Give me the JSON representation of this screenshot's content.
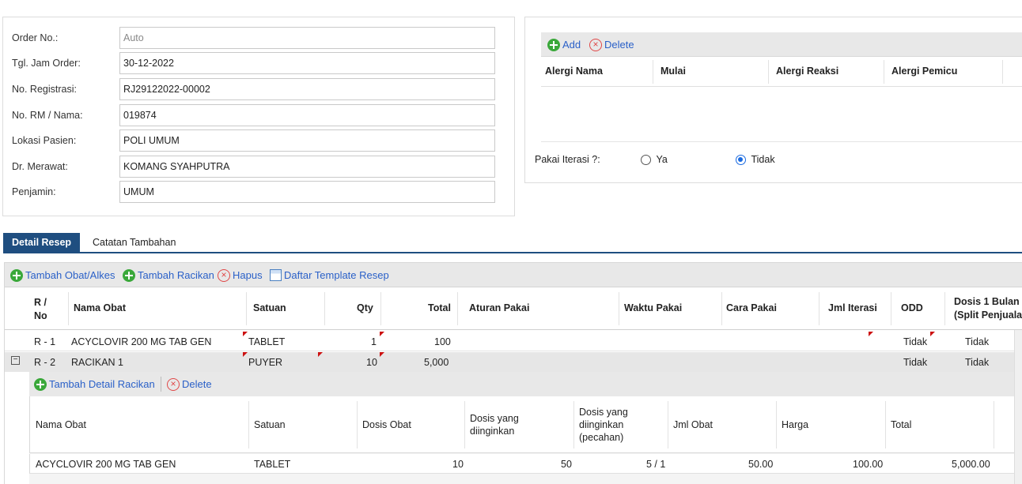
{
  "form": {
    "order_no": {
      "label": "Order No.:",
      "value": "Auto"
    },
    "tgl_jam_order": {
      "label": "Tgl. Jam Order:",
      "value": "30-12-2022"
    },
    "no_registrasi": {
      "label": "No. Registrasi:",
      "value": "RJ29122022-00002"
    },
    "no_rm_nama": {
      "label": "No. RM / Nama:",
      "value": "019874"
    },
    "lokasi_pasien": {
      "label": "Lokasi Pasien:",
      "value": "POLI UMUM"
    },
    "dr_merawat": {
      "label": "Dr. Merawat:",
      "value": "KOMANG SYAHPUTRA"
    },
    "penjamin": {
      "label": "Penjamin:",
      "value": "UMUM"
    }
  },
  "allergy": {
    "add_label": "Add",
    "delete_label": "Delete",
    "columns": [
      "Alergi Nama",
      "Mulai",
      "Alergi Reaksi",
      "Alergi Pemicu"
    ]
  },
  "iterasi": {
    "label": "Pakai Iterasi ?:",
    "option_ya": "Ya",
    "option_tidak": "Tidak",
    "selected": "Tidak"
  },
  "tabs": {
    "detail_resep": "Detail Resep",
    "catatan_tambahan": "Catatan Tambahan"
  },
  "toolbar": {
    "tambah_obat": "Tambah Obat/Alkes",
    "tambah_racikan": "Tambah Racikan",
    "hapus": "Hapus",
    "daftar_template": "Daftar Template Resep"
  },
  "grid": {
    "headers": {
      "r_no_1": "R /",
      "r_no_2": "No",
      "nama_obat": "Nama Obat",
      "satuan": "Satuan",
      "qty": "Qty",
      "total": "Total",
      "aturan_pakai": "Aturan Pakai",
      "waktu_pakai": "Waktu Pakai",
      "cara_pakai": "Cara Pakai",
      "jml_iterasi": "Jml Iterasi",
      "odd": "ODD",
      "dosis_1": "Dosis 1 Bulan",
      "dosis_2": "(Split Penjualan)"
    },
    "rows": [
      {
        "no": "R - 1",
        "nama": "ACYCLOVIR 200 MG TAB GEN",
        "satuan": "TABLET",
        "qty": "1",
        "total": "100",
        "odd": "Tidak",
        "dosis": "Tidak"
      },
      {
        "no": "R - 2",
        "nama": "RACIKAN 1",
        "satuan": "PUYER",
        "qty": "10",
        "total": "5,000",
        "odd": "Tidak",
        "dosis": "Tidak"
      }
    ]
  },
  "sub": {
    "tambah_detail": "Tambah Detail Racikan",
    "delete_label": "Delete",
    "headers": {
      "nama_obat": "Nama Obat",
      "satuan": "Satuan",
      "dosis_obat": "Dosis Obat",
      "dosis_diinginkan_1": "Dosis yang",
      "dosis_diinginkan_2": "diinginkan",
      "dosis_pecahan_1": "Dosis yang",
      "dosis_pecahan_2": "diinginkan",
      "dosis_pecahan_3": "(pecahan)",
      "jml_obat": "Jml Obat",
      "harga": "Harga",
      "total": "Total"
    },
    "row": {
      "nama": "ACYCLOVIR 200 MG TAB GEN",
      "satuan": "TABLET",
      "dosis_obat": "10",
      "dosis_diinginkan": "50",
      "dosis_pecahan": "5 / 1",
      "jml_obat": "50.00",
      "harga": "100.00",
      "total": "5,000.00"
    }
  }
}
